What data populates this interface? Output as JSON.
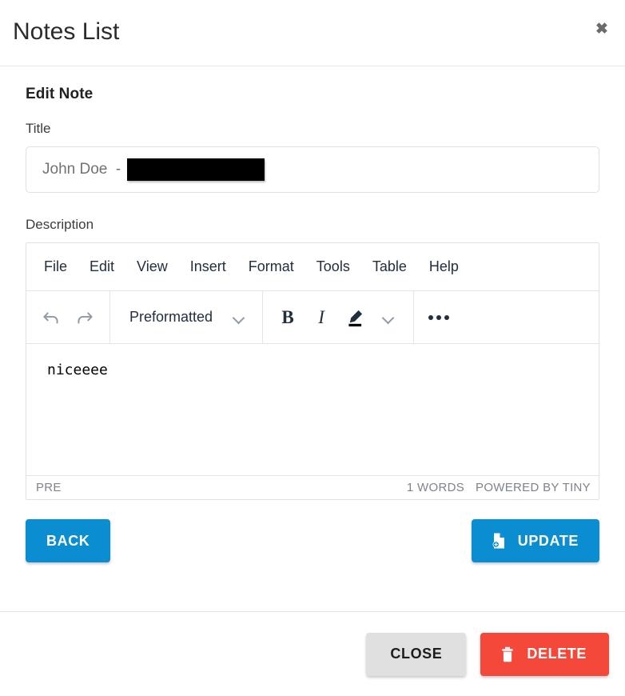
{
  "header": {
    "title": "Notes List",
    "close_icon": "close-x-icon"
  },
  "body": {
    "section_heading": "Edit Note",
    "title_field": {
      "label": "Title",
      "value": "John Doe  - ",
      "redacted": true
    },
    "description_field": {
      "label": "Description"
    }
  },
  "editor": {
    "menubar": [
      {
        "label": "File"
      },
      {
        "label": "Edit"
      },
      {
        "label": "View"
      },
      {
        "label": "Insert"
      },
      {
        "label": "Format"
      },
      {
        "label": "Tools"
      },
      {
        "label": "Table"
      },
      {
        "label": "Help"
      }
    ],
    "toolbar": {
      "undo_icon": "undo-arrow-icon",
      "redo_icon": "redo-arrow-icon",
      "format_select": "Preformatted",
      "bold_label": "B",
      "italic_label": "I",
      "text_color_icon": "highlighter-pen-icon",
      "more_icon": "more-horizontal-icon"
    },
    "content": "niceeee",
    "statusbar": {
      "element_path": "PRE",
      "word_count": "1 WORDS",
      "branding": "POWERED BY TINY"
    }
  },
  "actions": {
    "back_label": "BACK",
    "update_label": "UPDATE",
    "update_icon": "file-add-icon"
  },
  "footer": {
    "close_label": "CLOSE",
    "delete_label": "DELETE",
    "delete_icon": "trash-icon"
  },
  "colors": {
    "primary_blue": "#0b8ed1",
    "danger_red": "#f4483a",
    "neutral_grey": "#e0e0e0",
    "editor_ink": "#222f3e"
  }
}
